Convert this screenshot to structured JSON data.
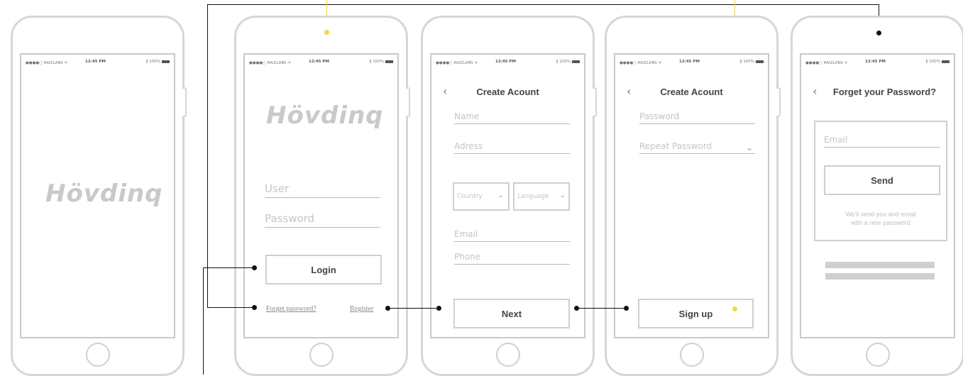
{
  "status": {
    "carrier": "●●●●○ RAIZLABS ᯤ",
    "time": "12:45 PM",
    "battery": "∦ 100%"
  },
  "splash": {
    "logo": "Hövdinq"
  },
  "login": {
    "logo": "Hövdinq",
    "user_placeholder": "User",
    "password_placeholder": "Password",
    "login_label": "Login",
    "forget_link": "Forget password?",
    "register_link": "Register"
  },
  "create1": {
    "back": "‹",
    "title": "Create Acount",
    "name_placeholder": "Name",
    "address_placeholder": "Adress",
    "country_label": "Country",
    "language_label": "Language",
    "email_placeholder": "Email",
    "phone_placeholder": "Phone",
    "next_label": "Next"
  },
  "create2": {
    "back": "‹",
    "title": "Create Acount",
    "password_placeholder": "Password",
    "repeat_placeholder": "Repeat Password",
    "signup_label": "Sign up"
  },
  "forgot": {
    "back": "‹",
    "title": "Forget your Password?",
    "email_placeholder": "Email",
    "send_label": "Send",
    "note_line1": "We'll send you and email",
    "note_line2": "with a new password"
  },
  "icons": {
    "chevron": "⌄",
    "check": "✓"
  },
  "colors": {
    "connector": "#111111",
    "highlight": "#f4d845",
    "wire": "#cfcfcf"
  }
}
